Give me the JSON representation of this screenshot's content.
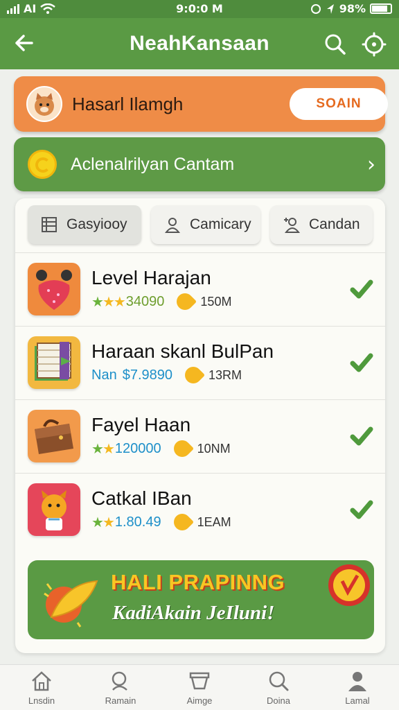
{
  "status_bar": {
    "carrier": "AI",
    "time": "9:0:0 M",
    "battery": "98%"
  },
  "app_bar": {
    "title": "NeahKansaan"
  },
  "profile_card": {
    "name": "Hasarl Ilamgh",
    "button": "SOAIN",
    "color": "#ef8c47"
  },
  "achievement_card": {
    "label": "Aclenalrilyan Cantam",
    "color": "#5e9a46"
  },
  "filters": [
    {
      "label": "Gasyiooy",
      "icon": "list-icon"
    },
    {
      "label": "Camicary",
      "icon": "user-icon"
    },
    {
      "label": "Candan",
      "icon": "user-add-icon"
    }
  ],
  "items": [
    {
      "title": "Level Harajan",
      "meta": "★★★",
      "value": "34090",
      "duration": "150M",
      "icon": "strawberry-icon"
    },
    {
      "title": "Haraan ѕkanl BulPan",
      "meta": "Nan",
      "value": "$7.9890",
      "duration": "13RM",
      "icon": "book-icon"
    },
    {
      "title": "Fayel Haan",
      "meta": "★★",
      "value": "120000",
      "duration": "10NM",
      "icon": "bag-icon"
    },
    {
      "title": "Catkal IBan",
      "meta": "★★",
      "value": "1.80.49",
      "duration": "1EAM",
      "icon": "character-icon"
    }
  ],
  "banner": {
    "headline": "HALI PRAPINNG",
    "subline": "KadiAkain JeIluni!"
  },
  "bottom_nav": [
    {
      "label": "Lnsdin",
      "icon": "home-icon"
    },
    {
      "label": "Ramain",
      "icon": "search-icon"
    },
    {
      "label": "Aimge",
      "icon": "chat-icon"
    },
    {
      "label": "Doina",
      "icon": "search-icon"
    },
    {
      "label": "Lamal",
      "icon": "profile-icon"
    }
  ]
}
